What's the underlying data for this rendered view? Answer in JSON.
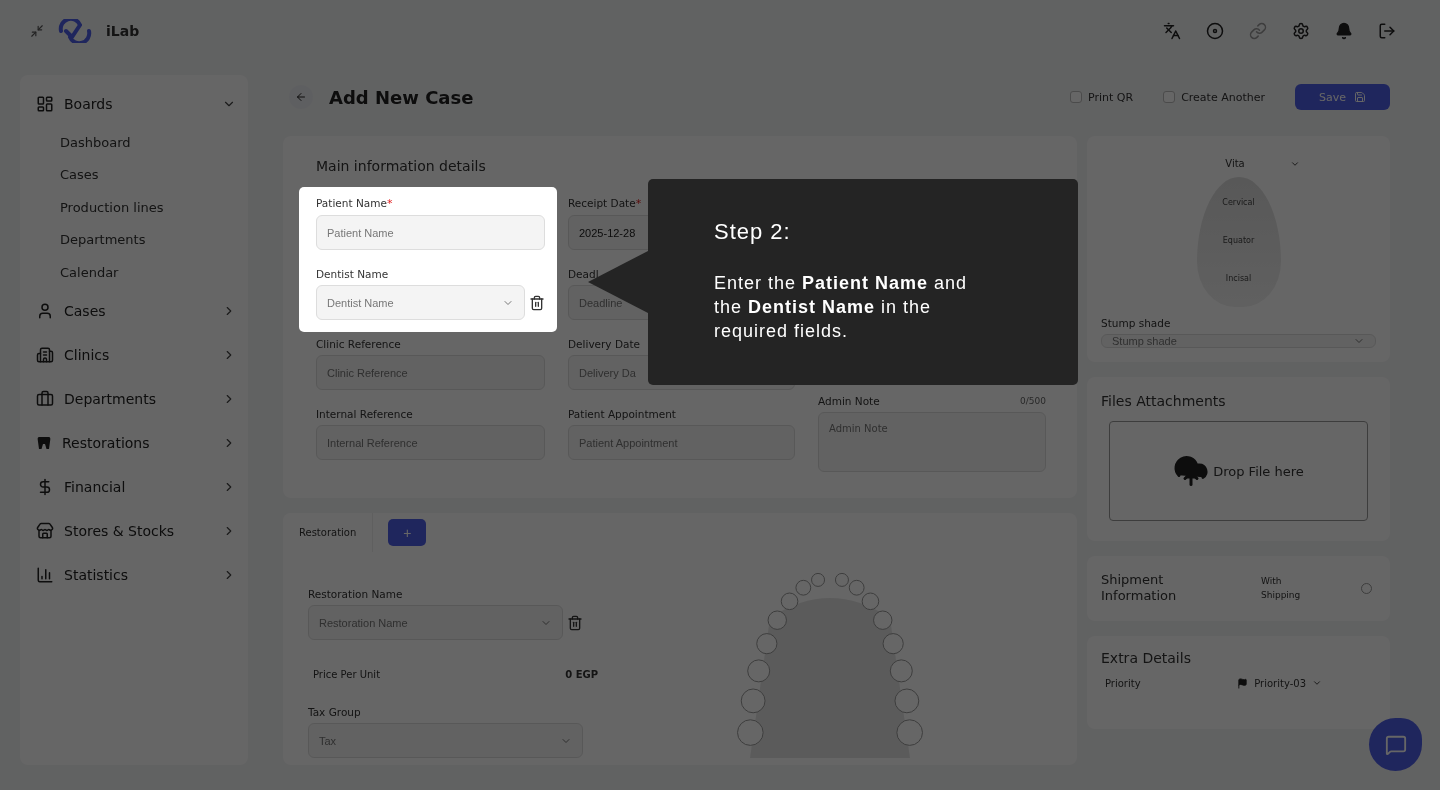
{
  "topbar": {
    "brand": "iLab"
  },
  "sidebar": {
    "items": [
      {
        "label": "Boards",
        "expanded": true,
        "children": [
          {
            "label": "Dashboard"
          },
          {
            "label": "Cases"
          },
          {
            "label": "Production lines"
          },
          {
            "label": "Departments"
          },
          {
            "label": "Calendar"
          }
        ]
      },
      {
        "label": "Cases",
        "expanded": false
      },
      {
        "label": "Clinics",
        "expanded": false
      },
      {
        "label": "Departments",
        "expanded": false
      },
      {
        "label": "Restorations",
        "expanded": false
      },
      {
        "label": "Financial",
        "expanded": false
      },
      {
        "label": "Stores & Stocks",
        "expanded": false
      },
      {
        "label": "Statistics",
        "expanded": false
      }
    ]
  },
  "page": {
    "title": "Add New Case",
    "options": [
      {
        "label": "Print QR",
        "checked": false
      },
      {
        "label": "Create Another",
        "checked": false
      }
    ],
    "save_button": "Save"
  },
  "main_info": {
    "title": "Main information details",
    "columns": [
      [
        {
          "kind": "text",
          "label": "Patient Name",
          "required_mark": "*",
          "placeholder": "Patient Name",
          "highlighted": true
        },
        {
          "kind": "select-delete",
          "label": "Dentist Name",
          "placeholder": "Dentist Name",
          "highlighted": true
        },
        {
          "kind": "text",
          "label": "Clinic Reference",
          "placeholder": "Clinic Reference",
          "highlighted": false
        },
        {
          "kind": "text",
          "label": "Internal Reference",
          "placeholder": "Internal Reference",
          "highlighted": false
        }
      ],
      [
        {
          "kind": "text",
          "label": "Receipt Date",
          "required_mark": "*",
          "value": "2025-12-28",
          "highlighted": false
        },
        {
          "kind": "text",
          "label": "Deadl",
          "placeholder": "Deadline",
          "highlighted": false
        },
        {
          "kind": "text",
          "label": "Delivery Date",
          "placeholder": "Delivery Da",
          "highlighted": false
        },
        {
          "kind": "text",
          "label": "Patient Appointment",
          "placeholder": "Patient Appointment",
          "highlighted": false
        }
      ],
      [
        {
          "kind": "textarea",
          "label": "Admin Note",
          "counter": "0/500",
          "placeholder": "Admin Note",
          "highlighted": false
        }
      ]
    ]
  },
  "restorations": {
    "tabs": [
      {
        "label": "Restoration",
        "selected": true
      }
    ],
    "add_button": "+",
    "fields": [
      {
        "kind": "select-delete",
        "label": "Restoration Name",
        "placeholder": "Restoration Name"
      },
      {
        "kind": "price",
        "label": "Price Per Unit",
        "value": "0 EGP"
      },
      {
        "kind": "select",
        "label": "Tax Group",
        "placeholder": "Tax"
      }
    ]
  },
  "shade": {
    "system": "Vita",
    "zones": [
      "Cervical",
      "Equator",
      "Incisal"
    ],
    "stump_label": "Stump shade",
    "stump_placeholder": "Stump shade"
  },
  "files": {
    "title": "Files Attachments",
    "drop_text": "Drop File here"
  },
  "shipment": {
    "title": "Shipment Information",
    "option": "With Shipping",
    "checked": false
  },
  "extra": {
    "title": "Extra Details",
    "rows": [
      {
        "label": "Priority",
        "value": "Priority-03"
      }
    ]
  },
  "tooltip": {
    "title": "Step 2:",
    "text": "Enter the **Patient Name** and the **Dentist Name** in the required fields."
  }
}
